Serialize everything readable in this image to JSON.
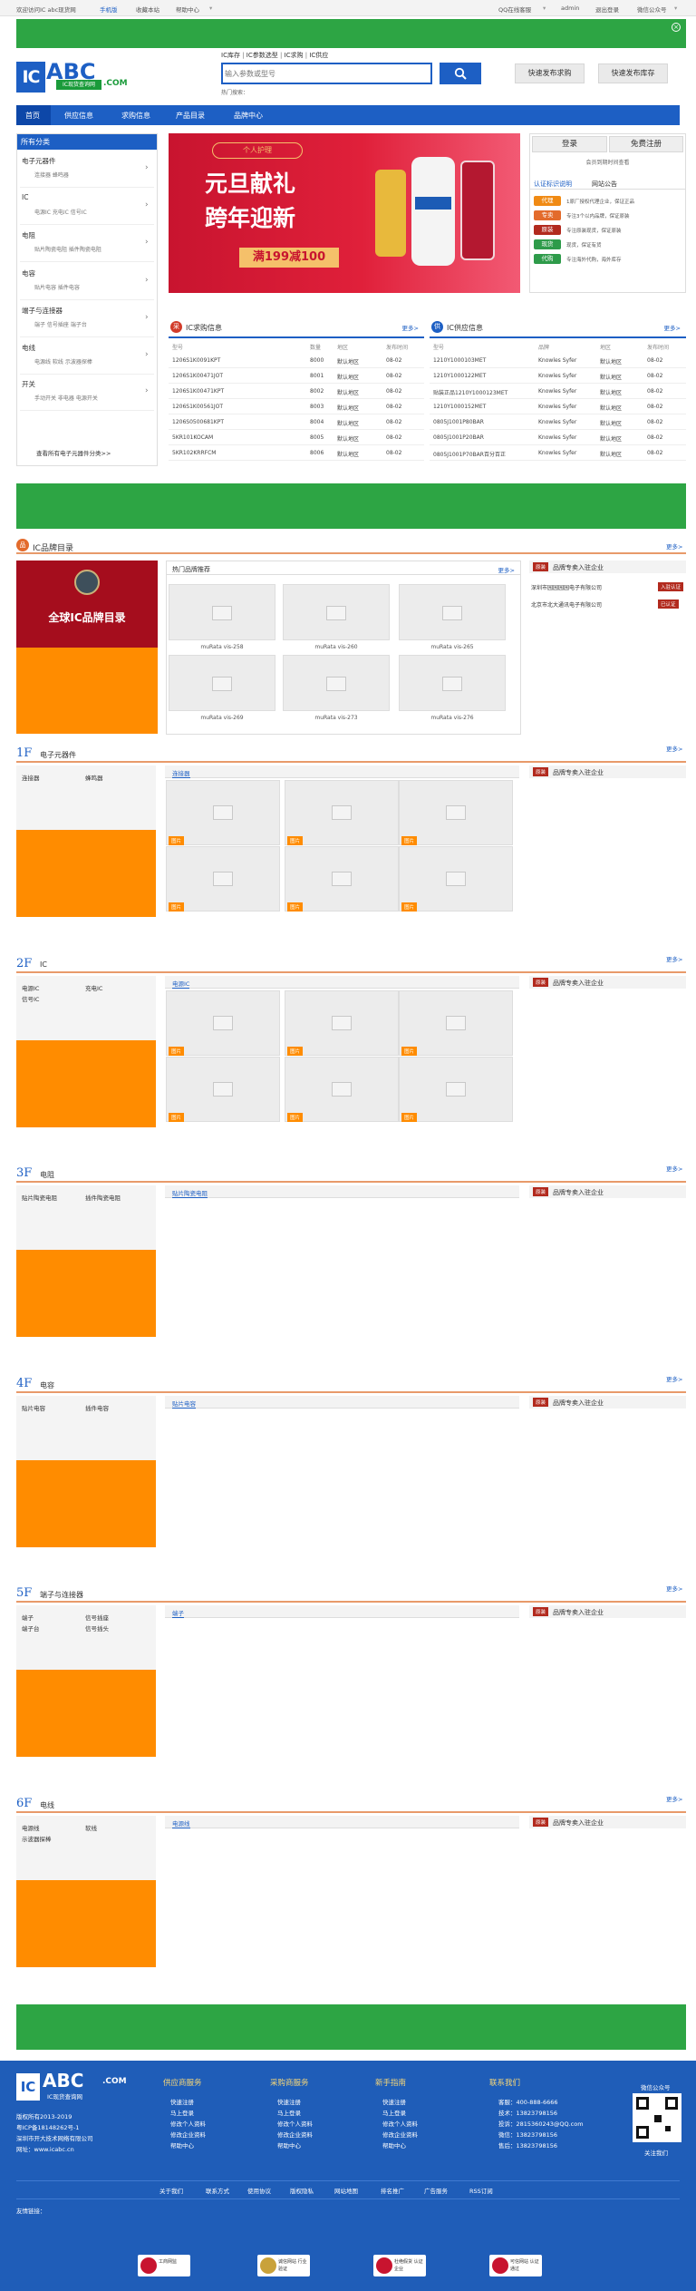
{
  "topbar": {
    "welcome": "欢迎访问IC abc现货网",
    "mobile": "手机版",
    "favorites": "收藏本站",
    "help": "帮助中心",
    "qq": "QQ在线客服",
    "admin": "admin",
    "logout": "退出登录",
    "wechat": "微信公众号"
  },
  "header": {
    "logo_ic": "IC",
    "logo_abc": "ABC",
    "logo_sub": "IC现货查询网",
    "logo_com": ".COM",
    "search_tabs": [
      "IC库存",
      "IC参数选型",
      "IC求购",
      "IC供应"
    ],
    "search_placeholder": "输入参数或型号",
    "hot_search": "热门搜索：",
    "btn_post_purchase": "快速发布求购",
    "btn_post_stock": "快速发布库存"
  },
  "nav": {
    "items": [
      "首页",
      "供应信息",
      "求购信息",
      "产品目录",
      "品牌中心"
    ]
  },
  "sidebar": {
    "title": "所有分类",
    "categories": [
      {
        "name": "电子元器件",
        "sub": "连接器 蜂鸣器"
      },
      {
        "name": "IC",
        "sub": "电源IC 充电IC 信号IC"
      },
      {
        "name": "电阻",
        "sub": "贴片陶瓷电阻 插件陶瓷电阻"
      },
      {
        "name": "电容",
        "sub": "贴片电容 插件电容"
      },
      {
        "name": "端子与连接器",
        "sub": "端子 信号插座 端子台"
      },
      {
        "name": "电线",
        "sub": "电源线 软线 示波器探棒"
      },
      {
        "name": "开关",
        "sub": "手动开关 非电器 电源开关"
      }
    ],
    "view_all": "查看所有电子元器件分类>>"
  },
  "promo": {
    "small": "个人护理",
    "big1": "元旦献礼",
    "big2": "跨年迎新",
    "offer": "满199减100"
  },
  "login": {
    "login_btn": "登录",
    "register_btn": "免费注册",
    "member_note": "会员到期时间查看",
    "tab_cert": "认证标识说明",
    "tab_notice": "网站公告",
    "certs": [
      {
        "tag": "代理",
        "text": "1原厂授权代理企业，保证正品"
      },
      {
        "tag": "专卖",
        "text": "专注3个以内品牌，保证原装"
      },
      {
        "tag": "原装",
        "text": "专注原装现货，保证原装"
      },
      {
        "tag": "现货",
        "text": "现货，保证有货"
      },
      {
        "tag": "代购",
        "text": "专注海外代购，海外库存"
      }
    ]
  },
  "purchase": {
    "title": "IC求购信息",
    "more": "更多>",
    "headers": [
      "型号",
      "数量",
      "地区",
      "发布时间"
    ],
    "rows": [
      [
        "1206S1K0091KPT",
        "8000",
        "默认地区",
        "08-02"
      ],
      [
        "1206S1K00471JOT",
        "8001",
        "默认地区",
        "08-02"
      ],
      [
        "1206S1K00471KPT",
        "8002",
        "默认地区",
        "08-02"
      ],
      [
        "1206S1K00561JOT",
        "8003",
        "默认地区",
        "08-02"
      ],
      [
        "1206S0500681KPT",
        "8004",
        "默认地区",
        "08-02"
      ],
      [
        "5KR101KOCAM",
        "8005",
        "默认地区",
        "08-02"
      ],
      [
        "5KR102KRRFCM",
        "8006",
        "默认地区",
        "08-02"
      ]
    ]
  },
  "supply": {
    "title": "IC供应信息",
    "more": "更多>",
    "headers": [
      "型号",
      "品牌",
      "地区",
      "发布时间"
    ],
    "rows": [
      [
        "1210Y1000103MET",
        "Knowles Syfer",
        "默认地区",
        "08-02"
      ],
      [
        "1210Y1000122MET",
        "Knowles Syfer",
        "默认地区",
        "08-02"
      ],
      [
        "贴装正品1210Y1000123MET",
        "Knowles Syfer",
        "默认地区",
        "08-02"
      ],
      [
        "1210Y1000152MET",
        "Knowles Syfer",
        "默认地区",
        "08-02"
      ],
      [
        "0805J1001P80BAR",
        "Knowles Syfer",
        "默认地区",
        "08-02"
      ],
      [
        "0805J1001P20BAR",
        "Knowles Syfer",
        "默认地区",
        "08-02"
      ],
      [
        "0805J1001P70BAR百分百正",
        "Knowles Syfer",
        "默认地区",
        "08-02"
      ]
    ]
  },
  "brands": {
    "title": "IC品牌目录",
    "more": "更多>",
    "left_banner": "全球IC品牌目录",
    "hot_title": "热门品牌推荐",
    "hot_more": "更多>",
    "items": [
      "muRata vis-258",
      "muRata vis-260",
      "muRata vis-265",
      "muRata vis-269",
      "muRata vis-273",
      "muRata vis-276"
    ],
    "vip_title": "品牌专卖入驻企业",
    "vip_companies": [
      {
        "name": "深圳市园园园园电子有限公司",
        "tag": "入驻认证"
      },
      {
        "name": "北京市北大通讯电子有限公司",
        "tag": "已认证"
      }
    ]
  },
  "floors": [
    {
      "no": "1F",
      "name": "电子元器件",
      "subs": [
        "连接器",
        "蜂鸣器"
      ],
      "tab": "连接器",
      "more": "更多>",
      "vip": "品牌专卖入驻企业",
      "tiles": 6
    },
    {
      "no": "2F",
      "name": "IC",
      "subs": [
        "电源IC",
        "充电IC",
        "信号IC"
      ],
      "tab": "电源IC",
      "more": "更多>",
      "vip": "品牌专卖入驻企业",
      "tiles": 6
    },
    {
      "no": "3F",
      "name": "电阻",
      "subs": [
        "贴片陶瓷电阻",
        "插件陶瓷电阻"
      ],
      "tab": "贴片陶瓷电阻",
      "more": "更多>",
      "vip": "品牌专卖入驻企业",
      "tiles": 0
    },
    {
      "no": "4F",
      "name": "电容",
      "subs": [
        "贴片电容",
        "插件电容"
      ],
      "tab": "贴片电容",
      "more": "更多>",
      "vip": "品牌专卖入驻企业",
      "tiles": 0
    },
    {
      "no": "5F",
      "name": "端子与连接器",
      "subs": [
        "端子",
        "信号插座",
        "端子台",
        "信号插头"
      ],
      "tab": "端子",
      "more": "更多>",
      "vip": "品牌专卖入驻企业",
      "tiles": 0
    },
    {
      "no": "6F",
      "name": "电线",
      "subs": [
        "电源线",
        "软线",
        "示波器探棒"
      ],
      "tab": "电源线",
      "more": "更多>",
      "vip": "品牌专卖入驻企业",
      "tiles": 0
    }
  ],
  "tile_label": "图片",
  "vip_tag": "原装",
  "footer": {
    "logo_ic": "IC",
    "logo_abc": "ABC",
    "logo_com": ".COM",
    "logo_sub": "IC现货查询网",
    "info": [
      "版权所有2013-2019",
      "粤ICP备18148262号-1",
      "深圳市开大技术网络有限公司",
      "网址：www.icabc.cn"
    ],
    "cols": [
      {
        "title": "供应商服务",
        "items": [
          "快速注册",
          "马上登录",
          "修改个人资料",
          "修改企业资料",
          "帮助中心"
        ]
      },
      {
        "title": "采购商服务",
        "items": [
          "快速注册",
          "马上登录",
          "修改个人资料",
          "修改企业资料",
          "帮助中心"
        ]
      },
      {
        "title": "新手指南",
        "items": [
          "快速注册",
          "马上登录",
          "修改个人资料",
          "修改企业资料",
          "帮助中心"
        ]
      }
    ],
    "contact_title": "联系我们",
    "contacts": [
      "客服：400-888-6666",
      "技术：13823798156",
      "投诉：2815360243@QQ.com",
      "微信：13823798156",
      "售后：13823798156"
    ],
    "qr_label": "微信公众号",
    "follow": "关注我们",
    "links": [
      "关于我们",
      "联系方式",
      "使用协议",
      "版权隐私",
      "网站地图",
      "排名推广",
      "广告服务",
      "RSS订阅"
    ],
    "friend_links": "友情链接：",
    "badges": [
      "工商网监",
      "诚信网站 行业验证",
      "杜绝假货 认证企业",
      "可信网站 认证通过"
    ]
  }
}
